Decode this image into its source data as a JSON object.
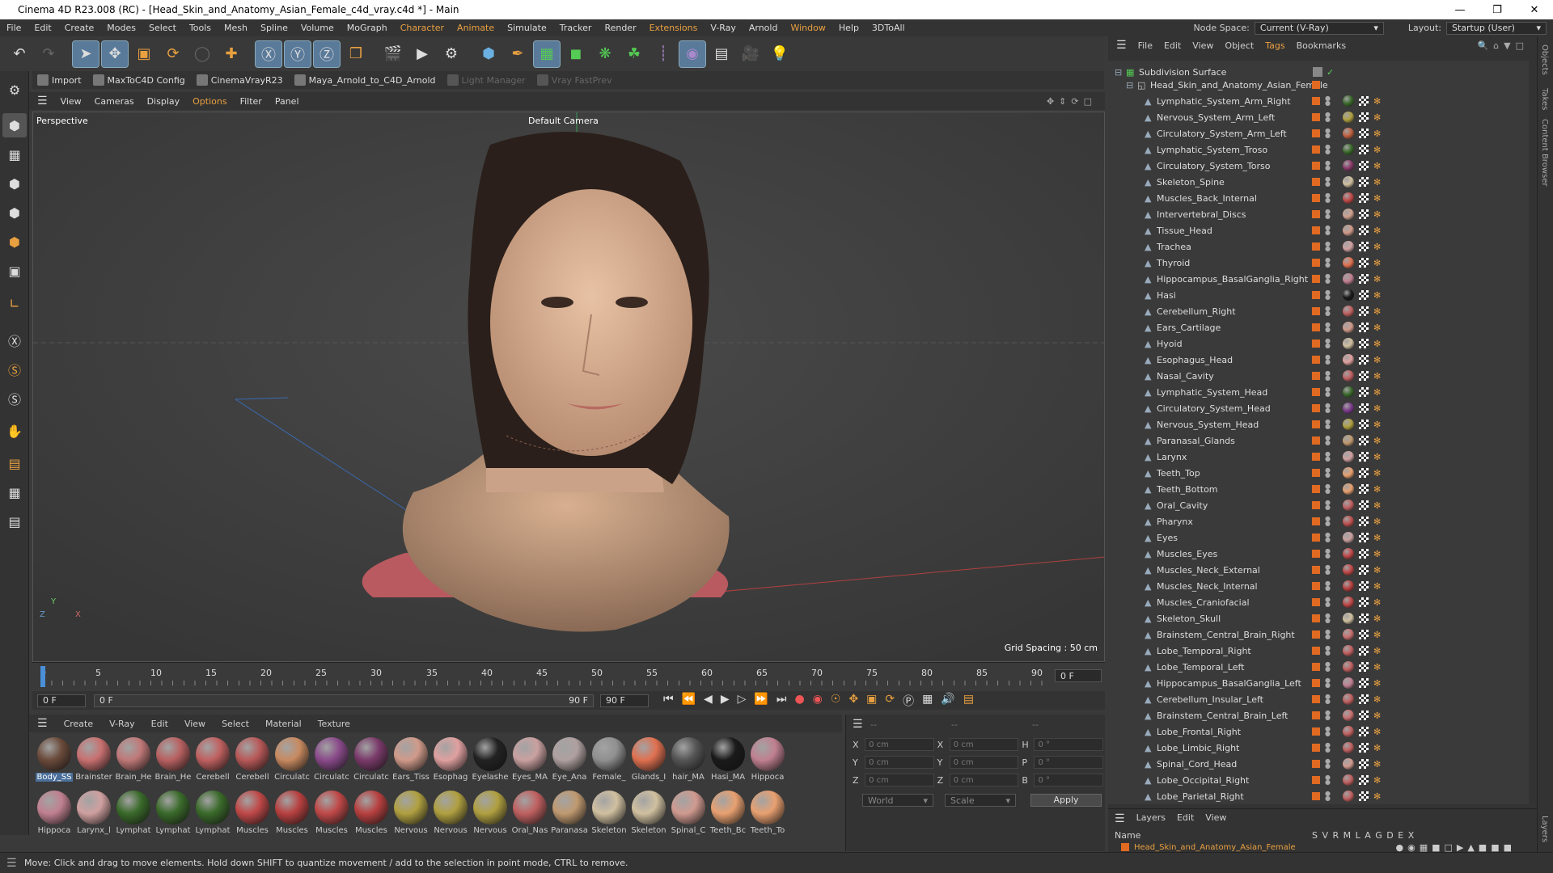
{
  "window": {
    "title": "Cinema 4D R23.008 (RC) - [Head_Skin_and_Anatomy_Asian_Female_c4d_vray.c4d *] - Main"
  },
  "menu": {
    "items": [
      "File",
      "Edit",
      "Create",
      "Modes",
      "Select",
      "Tools",
      "Mesh",
      "Spline",
      "Volume",
      "MoGraph",
      "Character",
      "Animate",
      "Simulate",
      "Tracker",
      "Render",
      "Extensions",
      "V-Ray",
      "Arnold",
      "Window",
      "Help",
      "3DToAll"
    ],
    "node_space_label": "Node Space:",
    "node_space_value": "Current (V-Ray)",
    "layout_label": "Layout:",
    "layout_value": "Startup (User)"
  },
  "toolbar2": {
    "import": "Import",
    "maxtoc4d": "MaxToC4D Config",
    "cinemavray": "CinemaVrayR23",
    "maya": "Maya_Arnold_to_C4D_Arnold",
    "lightmgr": "Light Manager",
    "vrayfast": "Vray FastPrev"
  },
  "viewport": {
    "menu": [
      "View",
      "Cameras",
      "Display",
      "Options",
      "Filter",
      "Panel"
    ],
    "label": "Perspective",
    "camera": "Default Camera",
    "grid_spacing": "Grid Spacing : 50 cm",
    "axis_y": "Y",
    "axis_z": "Z",
    "axis_x": "X"
  },
  "timeline": {
    "ticks": [
      "0",
      "5",
      "10",
      "15",
      "20",
      "25",
      "30",
      "35",
      "40",
      "45",
      "50",
      "55",
      "60",
      "65",
      "70",
      "75",
      "80",
      "85",
      "90"
    ],
    "current": "0 F",
    "start": "0 F",
    "range_start": "0 F",
    "range_end": "90 F",
    "end": "90 F",
    "frame_end": "90 F"
  },
  "materials": {
    "menu": [
      "Create",
      "V-Ray",
      "Edit",
      "View",
      "Select",
      "Material",
      "Texture"
    ],
    "row1": [
      {
        "label": "Body_SS",
        "color": "#6a4a3a"
      },
      {
        "label": "Brainster",
        "color": "#c87070"
      },
      {
        "label": "Brain_He",
        "color": "#c07878"
      },
      {
        "label": "Brain_He",
        "color": "#b86060"
      },
      {
        "label": "Cerebell",
        "color": "#c06060"
      },
      {
        "label": "Cerebell",
        "color": "#b85858"
      },
      {
        "label": "Circulatc",
        "color": "#c88a60"
      },
      {
        "label": "Circulatc",
        "color": "#8a4a8a"
      },
      {
        "label": "Circulatc",
        "color": "#7a3a6a"
      },
      {
        "label": "Ears_Tiss",
        "color": "#d09a8a"
      },
      {
        "label": "Esophag",
        "color": "#e0a0a0"
      },
      {
        "label": "Eyelashe",
        "color": "#222222"
      },
      {
        "label": "Eyes_MA",
        "color": "#caa0a0"
      },
      {
        "label": "Eye_Ana",
        "color": "#b0a0a0"
      },
      {
        "label": "Female_",
        "color": "#909090"
      },
      {
        "label": "Glands_I",
        "color": "#e07050"
      },
      {
        "label": "hair_MA",
        "color": "#555555"
      },
      {
        "label": "Hasi_MA",
        "color": "#1a1a1a"
      },
      {
        "label": "Hippoca",
        "color": "#c08090"
      }
    ],
    "row2": [
      {
        "label": "Hippoca",
        "color": "#c08090"
      },
      {
        "label": "Larynx_l",
        "color": "#d0a0a0"
      },
      {
        "label": "Lymphat",
        "color": "#3a6a2a"
      },
      {
        "label": "Lymphat",
        "color": "#3a6a2a"
      },
      {
        "label": "Lymphat",
        "color": "#3a6a2a"
      },
      {
        "label": "Muscles",
        "color": "#c04848"
      },
      {
        "label": "Muscles",
        "color": "#b84040"
      },
      {
        "label": "Muscles",
        "color": "#c04848"
      },
      {
        "label": "Muscles",
        "color": "#b84040"
      },
      {
        "label": "Nervous",
        "color": "#b0a040"
      },
      {
        "label": "Nervous",
        "color": "#b0a040"
      },
      {
        "label": "Nervous",
        "color": "#b0a040"
      },
      {
        "label": "Oral_Nas",
        "color": "#c06060"
      },
      {
        "label": "Paranasa",
        "color": "#c09a70"
      },
      {
        "label": "Skeleton",
        "color": "#d0c0a0"
      },
      {
        "label": "Skeleton",
        "color": "#d0c0a0"
      },
      {
        "label": "Spinal_C",
        "color": "#d09a90"
      },
      {
        "label": "Teeth_Bc",
        "color": "#e8a070"
      },
      {
        "label": "Teeth_To",
        "color": "#e8a070"
      }
    ]
  },
  "coords": {
    "header1": "--",
    "header2": "--",
    "header3": "--",
    "x_label": "X",
    "y_label": "Y",
    "z_label": "Z",
    "x_pos": "0 cm",
    "y_pos": "0 cm",
    "z_pos": "0 cm",
    "x_size_label": "X",
    "y_size_label": "Y",
    "z_size_label": "Z",
    "x_size": "0 cm",
    "y_size": "0 cm",
    "z_size": "0 cm",
    "h_label": "H",
    "p_label": "P",
    "b_label": "B",
    "h": "0 °",
    "p": "0 °",
    "b": "0 °",
    "world": "World",
    "scale": "Scale",
    "apply": "Apply"
  },
  "objects": {
    "menu": [
      "File",
      "Edit",
      "View",
      "Object",
      "Tags",
      "Bookmarks"
    ],
    "root": "Subdivision Surface",
    "group": "Head_Skin_and_Anatomy_Asian_Female",
    "items": [
      {
        "name": "Lymphatic_System_Arm_Right",
        "tag": "#3a6a2a"
      },
      {
        "name": "Nervous_System_Arm_Left",
        "tag": "#b0a040"
      },
      {
        "name": "Circulatory_System_Arm_Left",
        "tag": "#c06040"
      },
      {
        "name": "Lymphatic_System_Troso",
        "tag": "#3a6a2a"
      },
      {
        "name": "Circulatory_System_Torso",
        "tag": "#8a3a6a"
      },
      {
        "name": "Skeleton_Spine",
        "tag": "#d0c0a0"
      },
      {
        "name": "Muscles_Back_Internal",
        "tag": "#c04848"
      },
      {
        "name": "Intervertebral_Discs",
        "tag": "#d0a090"
      },
      {
        "name": "Tissue_Head",
        "tag": "#d09a8a"
      },
      {
        "name": "Trachea",
        "tag": "#d0a0a0"
      },
      {
        "name": "Thyroid",
        "tag": "#e07050"
      },
      {
        "name": "Hippocampus_BasalGanglia_Right",
        "tag": "#c08090"
      },
      {
        "name": "Hasi",
        "tag": "#1a1a1a"
      },
      {
        "name": "Cerebellum_Right",
        "tag": "#c06060"
      },
      {
        "name": "Ears_Cartilage",
        "tag": "#d09a8a"
      },
      {
        "name": "Hyoid",
        "tag": "#d0c0a0"
      },
      {
        "name": "Esophagus_Head",
        "tag": "#e0a0a0"
      },
      {
        "name": "Nasal_Cavity",
        "tag": "#c06060"
      },
      {
        "name": "Lymphatic_System_Head",
        "tag": "#3a6a2a"
      },
      {
        "name": "Circulatory_System_Head",
        "tag": "#7a3a8a"
      },
      {
        "name": "Nervous_System_Head",
        "tag": "#b0a040"
      },
      {
        "name": "Paranasal_Glands",
        "tag": "#c09a70"
      },
      {
        "name": "Larynx",
        "tag": "#d0a0a0"
      },
      {
        "name": "Teeth_Top",
        "tag": "#e8a070"
      },
      {
        "name": "Teeth_Bottom",
        "tag": "#e8a070"
      },
      {
        "name": "Oral_Cavity",
        "tag": "#c06060"
      },
      {
        "name": "Pharynx",
        "tag": "#c05050"
      },
      {
        "name": "Eyes",
        "tag": "#caa0a0"
      },
      {
        "name": "Muscles_Eyes",
        "tag": "#c04848"
      },
      {
        "name": "Muscles_Neck_External",
        "tag": "#c04848"
      },
      {
        "name": "Muscles_Neck_Internal",
        "tag": "#b84040"
      },
      {
        "name": "Muscles_Craniofacial",
        "tag": "#c04848"
      },
      {
        "name": "Skeleton_Skull",
        "tag": "#d0c0a0"
      },
      {
        "name": "Brainstem_Central_Brain_Right",
        "tag": "#c87070"
      },
      {
        "name": "Lobe_Temporal_Right",
        "tag": "#c06060"
      },
      {
        "name": "Lobe_Temporal_Left",
        "tag": "#c06060"
      },
      {
        "name": "Hippocampus_BasalGanglia_Left",
        "tag": "#c08090"
      },
      {
        "name": "Cerebellum_Insular_Left",
        "tag": "#c06060"
      },
      {
        "name": "Brainstem_Central_Brain_Left",
        "tag": "#c87070"
      },
      {
        "name": "Lobe_Frontal_Right",
        "tag": "#c06060"
      },
      {
        "name": "Lobe_Limbic_Right",
        "tag": "#c06060"
      },
      {
        "name": "Spinal_Cord_Head",
        "tag": "#d09a90"
      },
      {
        "name": "Lobe_Occipital_Right",
        "tag": "#c06060"
      },
      {
        "name": "Lobe_Parietal_Right",
        "tag": "#c06060"
      }
    ]
  },
  "layers": {
    "menu": [
      "Layers",
      "Edit",
      "View"
    ],
    "name_header": "Name",
    "cols": "S V R M L A G D E X",
    "item": "Head_Skin_and_Anatomy_Asian_Female"
  },
  "right_tabs": [
    "Objects",
    "Takes",
    "Content Browser",
    "Layers"
  ],
  "status": "Move: Click and drag to move elements. Hold down SHIFT to quantize movement / add to the selection in point mode, CTRL to remove."
}
